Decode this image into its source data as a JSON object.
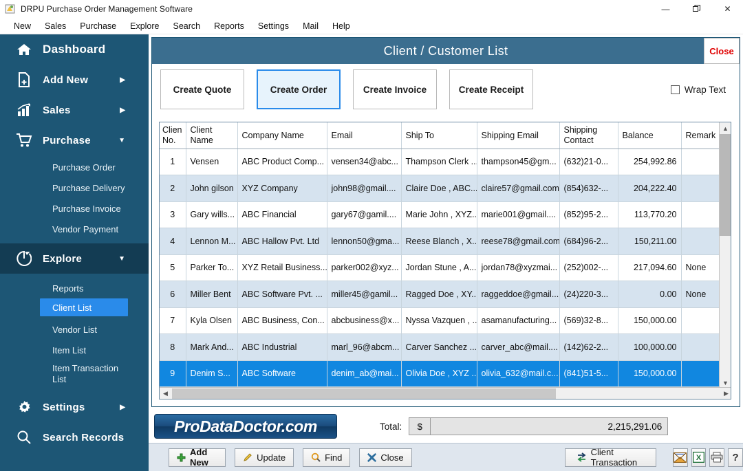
{
  "window": {
    "title": "DRPU Purchase Order Management Software",
    "minimize": "—",
    "maximize": "❐",
    "close": "✕"
  },
  "menubar": {
    "items": [
      "New",
      "Sales",
      "Purchase",
      "Explore",
      "Search",
      "Reports",
      "Settings",
      "Mail",
      "Help"
    ]
  },
  "sidebar": {
    "items": [
      {
        "label": "Dashboard",
        "icon": "home-icon",
        "arrow": ""
      },
      {
        "label": "Add New",
        "icon": "file-plus-icon",
        "arrow": "▶"
      },
      {
        "label": "Sales",
        "icon": "bar-chart-icon",
        "arrow": "▶"
      },
      {
        "label": "Purchase",
        "icon": "cart-icon",
        "arrow": "▼"
      },
      {
        "label": "Explore",
        "icon": "pie-chart-icon",
        "arrow": "▼"
      },
      {
        "label": "Settings",
        "icon": "gear-icon",
        "arrow": "▶"
      },
      {
        "label": "Search Records",
        "icon": "magnifier-icon",
        "arrow": ""
      }
    ],
    "purchase_sub": [
      "Purchase Order",
      "Purchase Delivery",
      "Purchase Invoice",
      "Vendor Payment"
    ],
    "explore_sub": [
      "Reports",
      "Client List",
      "Vendor List",
      "Item List",
      "Item Transaction List"
    ],
    "selected_sub": "Client List"
  },
  "panel": {
    "title": "Client / Customer List",
    "close_label": "Close",
    "actions": [
      {
        "label": "Create Quote",
        "focused": false
      },
      {
        "label": "Create Order",
        "focused": true
      },
      {
        "label": "Create Invoice",
        "focused": false
      },
      {
        "label": "Create Receipt",
        "focused": false
      }
    ],
    "wrap_text_label": "Wrap Text",
    "wrap_text_checked": false
  },
  "table": {
    "columns": [
      "Clien No.",
      "Client Name",
      "Company Name",
      "Email",
      "Ship To",
      "Shipping Email",
      "Shipping Contact",
      "Balance",
      "Remark"
    ],
    "rows": [
      {
        "no": "1",
        "name": "Vensen",
        "company": "ABC Product Comp...",
        "email": "vensen34@abc...",
        "ship_to": "Thampson Clerk ...",
        "ship_email": "thampson45@gm...",
        "ship_contact": "(632)21-0...",
        "balance": "254,992.86",
        "remark": ""
      },
      {
        "no": "2",
        "name": "John gilson",
        "company": "XYZ Company",
        "email": "john98@gmail....",
        "ship_to": "Claire Doe , ABC...",
        "ship_email": "claire57@gmail.com",
        "ship_contact": "(854)632-...",
        "balance": "204,222.40",
        "remark": ""
      },
      {
        "no": "3",
        "name": "Gary wills...",
        "company": "ABC Financial",
        "email": "gary67@gamil....",
        "ship_to": "Marie John , XYZ...",
        "ship_email": "marie001@gmail....",
        "ship_contact": "(852)95-2...",
        "balance": "113,770.20",
        "remark": ""
      },
      {
        "no": "4",
        "name": "Lennon M...",
        "company": "ABC Hallow Pvt. Ltd",
        "email": "lennon50@gma...",
        "ship_to": "Reese Blanch , X...",
        "ship_email": "reese78@gmail.com",
        "ship_contact": "(684)96-2...",
        "balance": "150,211.00",
        "remark": ""
      },
      {
        "no": "5",
        "name": "Parker To...",
        "company": "XYZ Retail Business...",
        "email": "parker002@xyz...",
        "ship_to": "Jordan Stune , A...",
        "ship_email": "jordan78@xyzmai...",
        "ship_contact": "(252)002-...",
        "balance": "217,094.60",
        "remark": "None"
      },
      {
        "no": "6",
        "name": "Miller Bent",
        "company": "ABC Software Pvt. ...",
        "email": "miller45@gamil...",
        "ship_to": "Ragged Doe , XY...",
        "ship_email": "raggeddoe@gmail...",
        "ship_contact": "(24)220-3...",
        "balance": "0.00",
        "remark": "None"
      },
      {
        "no": "7",
        "name": "Kyla Olsen",
        "company": "ABC Business, Con...",
        "email": "abcbusiness@x...",
        "ship_to": "Nyssa Vazquen , ...",
        "ship_email": "asamanufacturing...",
        "ship_contact": "(569)32-8...",
        "balance": "150,000.00",
        "remark": ""
      },
      {
        "no": "8",
        "name": "Mark And...",
        "company": "ABC Industrial",
        "email": "marl_96@abcm...",
        "ship_to": "Carver Sanchez ...",
        "ship_email": "carver_abc@mail....",
        "ship_contact": "(142)62-2...",
        "balance": "100,000.00",
        "remark": ""
      },
      {
        "no": "9",
        "name": "Denim S...",
        "company": "ABC Software",
        "email": "denim_ab@mai...",
        "ship_to": "Olivia Doe , XYZ ...",
        "ship_email": "olivia_632@mail.c...",
        "ship_contact": "(841)51-5...",
        "balance": "150,000.00",
        "remark": ""
      }
    ],
    "selected_row_index": 8
  },
  "total": {
    "label": "Total:",
    "currency": "$",
    "value": "2,215,291.06"
  },
  "branding": {
    "logo_text": "ProDataDoctor.com"
  },
  "footer": {
    "buttons": [
      {
        "label": "Add New",
        "icon": "plus-icon"
      },
      {
        "label": "Update",
        "icon": "pencil-icon"
      },
      {
        "label": "Find",
        "icon": "magnifier-icon"
      },
      {
        "label": "Close",
        "icon": "x-icon"
      }
    ],
    "client_transaction": {
      "label": "Client Transaction",
      "icon": "transfer-icon"
    },
    "icons": [
      "mail-icon",
      "excel-icon",
      "printer-icon",
      "help-icon"
    ]
  },
  "colors": {
    "sidebar_bg": "#1d5675",
    "sidebar_active": "#133c53",
    "accent": "#2a8bea",
    "header_bg": "#3b6e8f",
    "row_alt": "#d6e3ef",
    "row_selected": "#1187e0",
    "close_red": "#e00000"
  }
}
